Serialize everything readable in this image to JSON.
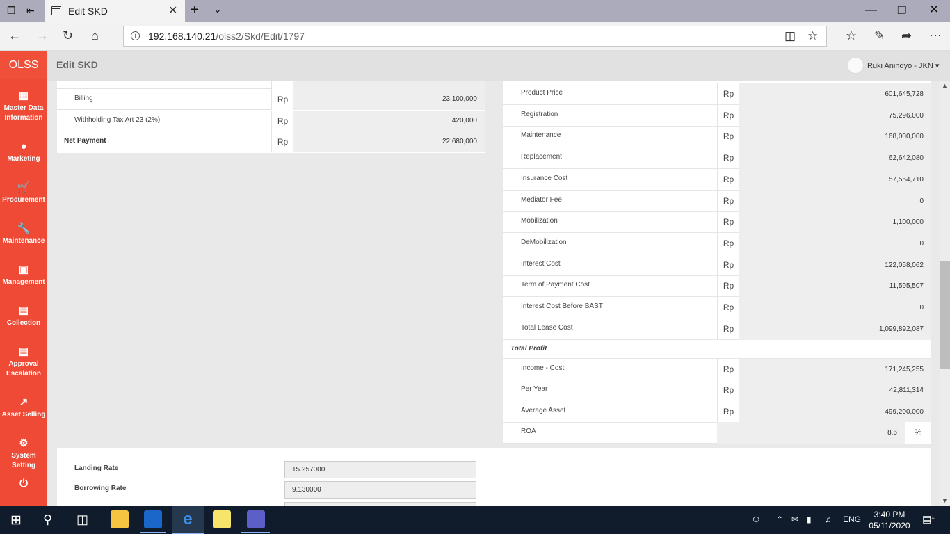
{
  "browser": {
    "tab_title": "Edit SKD",
    "url_host": "192.168.140.21",
    "url_path": "/olss2/Skd/Edit/1797"
  },
  "sidebar": {
    "brand": "OLSS",
    "items": [
      {
        "label": "Master Data Information",
        "icon": "grid-icon"
      },
      {
        "label": "Marketing",
        "icon": "globe-icon"
      },
      {
        "label": "Procurement",
        "icon": "cart-icon"
      },
      {
        "label": "Maintenance",
        "icon": "wrench-icon"
      },
      {
        "label": "Management",
        "icon": "truck-icon"
      },
      {
        "label": "Collection",
        "icon": "list-icon"
      },
      {
        "label": "Approval Escalation",
        "icon": "list-icon"
      },
      {
        "label": "Asset Selling",
        "icon": "external-link-icon"
      },
      {
        "label": "System Setting",
        "icon": "gear-icon"
      }
    ]
  },
  "header": {
    "title": "Edit SKD",
    "user": "Ruki Anindyo - JKN"
  },
  "left": {
    "rows": [
      {
        "label": "Billing",
        "currency": "Rp",
        "value": "23,100,000",
        "bold": false
      },
      {
        "label": "Withholding Tax Art 23 (2%)",
        "currency": "Rp",
        "value": "420,000",
        "bold": false
      },
      {
        "label": "Net Payment",
        "currency": "Rp",
        "value": "22,680,000",
        "bold": true
      }
    ]
  },
  "right": {
    "cost_rows": [
      {
        "label": "Product Price",
        "currency": "Rp",
        "value": "601,645,728"
      },
      {
        "label": "Registration",
        "currency": "Rp",
        "value": "75,296,000"
      },
      {
        "label": "Maintenance",
        "currency": "Rp",
        "value": "168,000,000"
      },
      {
        "label": "Replacement",
        "currency": "Rp",
        "value": "62,642,080"
      },
      {
        "label": "Insurance Cost",
        "currency": "Rp",
        "value": "57,554,710"
      },
      {
        "label": "Mediator Fee",
        "currency": "Rp",
        "value": "0"
      },
      {
        "label": "Mobilization",
        "currency": "Rp",
        "value": "1,100,000"
      },
      {
        "label": "DeMobilization",
        "currency": "Rp",
        "value": "0"
      },
      {
        "label": "Interest Cost",
        "currency": "Rp",
        "value": "122,058,062"
      },
      {
        "label": "Term of Payment Cost",
        "currency": "Rp",
        "value": "11,595,507"
      },
      {
        "label": "Interest Cost Before BAST",
        "currency": "Rp",
        "value": "0"
      },
      {
        "label": "Total Lease Cost",
        "currency": "Rp",
        "value": "1,099,892,087"
      }
    ],
    "profit_title": "Total Profit",
    "profit_rows": [
      {
        "label": "Income - Cost",
        "currency": "Rp",
        "value": "171,245,255"
      },
      {
        "label": "Per Year",
        "currency": "Rp",
        "value": "42,811,314"
      },
      {
        "label": "Average Asset",
        "currency": "Rp",
        "value": "499,200,000"
      }
    ],
    "roa": {
      "label": "ROA",
      "value": "8.6",
      "unit": "%"
    }
  },
  "bottom": {
    "rows": [
      {
        "label": "Landing Rate",
        "value": "15.257000"
      },
      {
        "label": "Borrowing Rate",
        "value": "9.130000"
      }
    ]
  },
  "taskbar": {
    "language": "ENG",
    "time": "3:40 PM",
    "date": "05/11/2020",
    "notifications": "1"
  }
}
